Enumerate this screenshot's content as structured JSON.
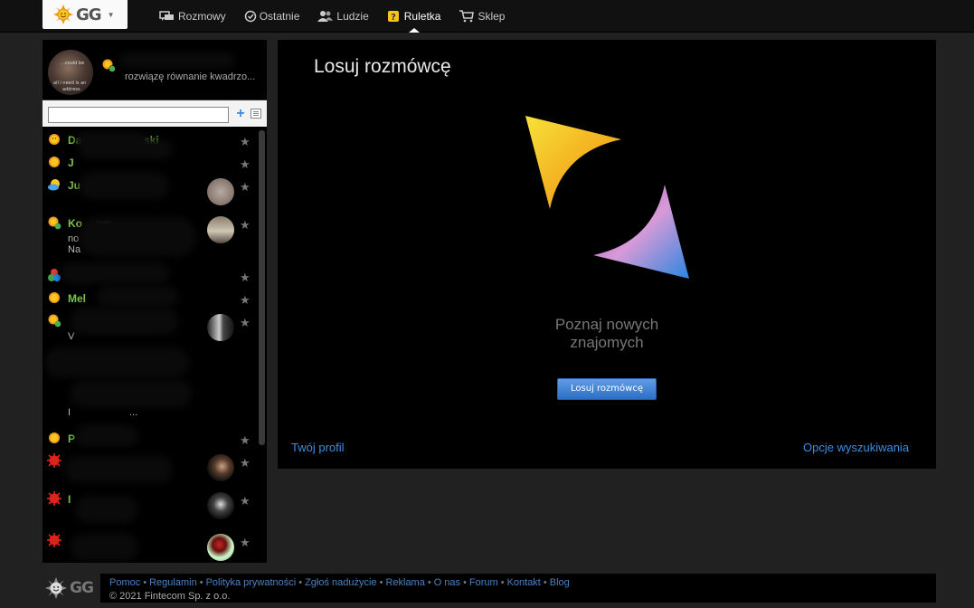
{
  "app": {
    "logo_text": "GG"
  },
  "nav": {
    "items": [
      {
        "label": "Rozmowy",
        "icon": "chat-bubbles-icon"
      },
      {
        "label": "Ostatnie",
        "icon": "clock-icon"
      },
      {
        "label": "Ludzie",
        "icon": "people-icon"
      },
      {
        "label": "Ruletka",
        "icon": "roulette-icon",
        "active": true
      },
      {
        "label": "Sklep",
        "icon": "cart-icon"
      }
    ]
  },
  "profile": {
    "avatar_text": [
      "...could be",
      "all i need is an",
      "address"
    ],
    "description": "rozwiązę równanie kwadrzo..."
  },
  "search": {
    "value": ""
  },
  "contacts": [
    {
      "name": "Da",
      "name_tail": "ski",
      "status": "online"
    },
    {
      "name": "J",
      "status": "online"
    },
    {
      "name": "Ju",
      "status": "away"
    },
    {
      "name": "Ko",
      "name_tail": "wn",
      "status": "online-mobile",
      "desc1": "no",
      "desc2": "Na"
    },
    {
      "name": "",
      "status": "busy-color"
    },
    {
      "name": "Mel",
      "status": "online"
    },
    {
      "name": "",
      "status": "online-mobile",
      "desc1": "V"
    },
    {
      "name": "",
      "status": "",
      "desc1": "I",
      "desc1_tail": "..."
    },
    {
      "name": "P",
      "status": "online"
    },
    {
      "name": "",
      "status": "offline"
    },
    {
      "name": "I",
      "status": "offline"
    },
    {
      "name": "",
      "status": "offline"
    }
  ],
  "main": {
    "title": "Losuj rozmówcę",
    "tagline_line1": "Poznaj nowych",
    "tagline_line2": "znajomych",
    "draw_button": "Losuj rozmówcę",
    "profile_link": "Twój profil",
    "options_link": "Opcje wyszukiwania"
  },
  "footer": {
    "logo_text": "GG",
    "links": [
      "Pomoc",
      "Regulamin",
      "Polityka prywatności",
      "Zgłoś nadużycie",
      "Reklama",
      "O nas",
      "Forum",
      "Kontakt",
      "Blog"
    ],
    "copyright": "© 2021 Fintecom Sp. z o.o."
  },
  "colors": {
    "accent": "#3d8de0",
    "online": "#7cc34a",
    "sun_orange": "#f29a1a",
    "offline_red": "#d9251c"
  }
}
